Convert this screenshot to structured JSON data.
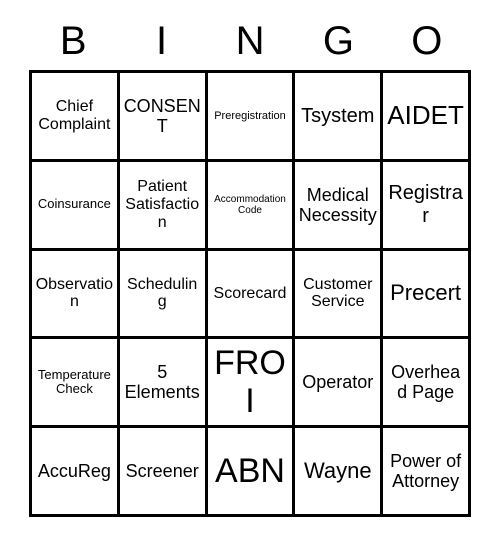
{
  "card": {
    "title_letters": [
      "B",
      "I",
      "N",
      "G",
      "O"
    ],
    "colors": {
      "background": "#ffffff",
      "grid_line": "#000000",
      "text": "#000000"
    },
    "grid": {
      "columns": 5,
      "rows": 5
    },
    "cells": [
      {
        "label": "Chief Complaint",
        "size": "md"
      },
      {
        "label": "CONSENT",
        "size": "lg"
      },
      {
        "label": "Preregistration",
        "size": "xs"
      },
      {
        "label": "Tsystem",
        "size": "xl"
      },
      {
        "label": "AIDET",
        "size": "3xl"
      },
      {
        "label": "Coinsurance",
        "size": "sm"
      },
      {
        "label": "Patient Satisfaction",
        "size": "md"
      },
      {
        "label": "Accommodation Code",
        "size": "xxs"
      },
      {
        "label": "Medical Necessity",
        "size": "lg"
      },
      {
        "label": "Registrar",
        "size": "xl"
      },
      {
        "label": "Observation",
        "size": "md"
      },
      {
        "label": "Scheduling",
        "size": "md"
      },
      {
        "label": "Scorecard",
        "size": "md"
      },
      {
        "label": "Customer Service",
        "size": "md"
      },
      {
        "label": "Precert",
        "size": "2xl"
      },
      {
        "label": "Temperature Check",
        "size": "sm"
      },
      {
        "label": "5 Elements",
        "size": "lg"
      },
      {
        "label": "FROI",
        "size": "4xl"
      },
      {
        "label": "Operator",
        "size": "lg"
      },
      {
        "label": "Overhead Page",
        "size": "lg"
      },
      {
        "label": "AccuReg",
        "size": "lg"
      },
      {
        "label": "Screener",
        "size": "lg"
      },
      {
        "label": "ABN",
        "size": "4xl"
      },
      {
        "label": "Wayne",
        "size": "2xl"
      },
      {
        "label": "Power of Attorney",
        "size": "lg"
      }
    ]
  }
}
